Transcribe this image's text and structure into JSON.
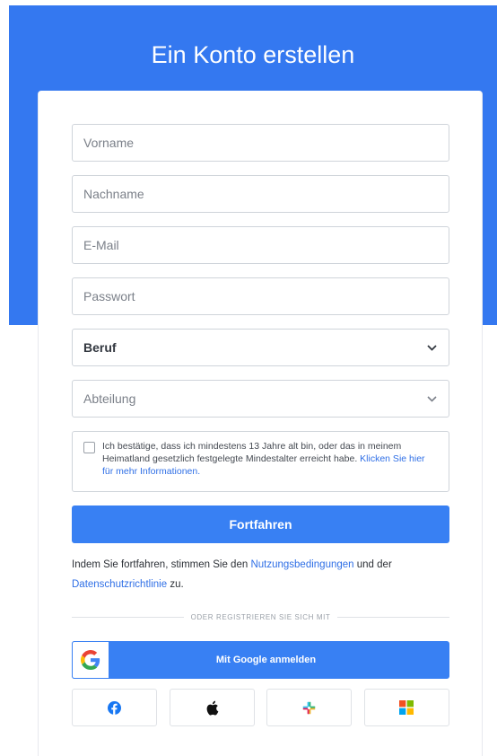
{
  "header": {
    "title": "Ein Konto erstellen"
  },
  "form": {
    "first_name": {
      "placeholder": "Vorname",
      "value": ""
    },
    "last_name": {
      "placeholder": "Nachname",
      "value": ""
    },
    "email": {
      "placeholder": "E-Mail",
      "value": ""
    },
    "password": {
      "placeholder": "Passwort",
      "value": ""
    },
    "profession": {
      "selected": "Beruf"
    },
    "department": {
      "selected": "Abteilung"
    },
    "consent": {
      "text": "Ich bestätige, dass ich mindestens 13 Jahre alt bin, oder das in meinem Heimatland gesetzlich festgelegte Mindestalter erreicht habe.",
      "link": "Klicken Sie hier für mehr Informationen."
    },
    "continue_label": "Fortfahren",
    "terms": {
      "prefix": "Indem Sie fortfahren, stimmen Sie den",
      "terms_link": "Nutzungsbedingungen",
      "middle": "und der",
      "privacy_link": "Datenschutzrichtlinie",
      "suffix": "zu."
    }
  },
  "social": {
    "divider": "ODER REGISTRIEREN SIE SICH MIT",
    "google_label": "Mit Google anmelden",
    "providers": [
      "facebook-icon",
      "apple-icon",
      "slack-icon",
      "microsoft-icon"
    ]
  },
  "colors": {
    "accent": "#3478f0",
    "button": "#3880f3",
    "link": "#2f6fe6",
    "google_blue": "#4285f4",
    "google_red": "#ea4335",
    "google_yellow": "#fbbc05",
    "google_green": "#34a853",
    "facebook": "#1877f2"
  }
}
